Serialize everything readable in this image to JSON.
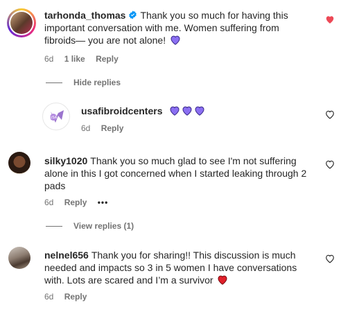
{
  "comments": [
    {
      "username": "tarhonda_thomas",
      "verified": true,
      "text": "Thank you so much for having this important conversation with me. Women suffering from fibroids— you are not alone!",
      "emoji": "purple-heart",
      "time": "6d",
      "likes": "1 like",
      "reply": "Reply",
      "liked": true,
      "toggle": "Hide replies"
    },
    {
      "username": "usafibroidcenters",
      "text": "",
      "emoji": "purple-heart x3",
      "time": "6d",
      "reply": "Reply",
      "liked": false
    },
    {
      "username": "silky1020",
      "text": "Thank you so much glad to see I'm not suffering alone in this I got concerned when I started leaking through 2 pads",
      "time": "6d",
      "reply": "Reply",
      "more": "•••",
      "liked": false,
      "toggle": "View replies (1)"
    },
    {
      "username": "nelnel656",
      "text": "Thank you for sharing!! This discussion is much needed and impacts so 3 in 5 women I have conversations with. Lots are scared and I’m a survivor",
      "emoji": "red-heart",
      "time": "6d",
      "reply": "Reply",
      "liked": false
    }
  ],
  "colors": {
    "liked_heart": "#ed4956",
    "verified": "#0095f6",
    "purple_heart": "#8b6ff2",
    "muted": "#737373"
  }
}
